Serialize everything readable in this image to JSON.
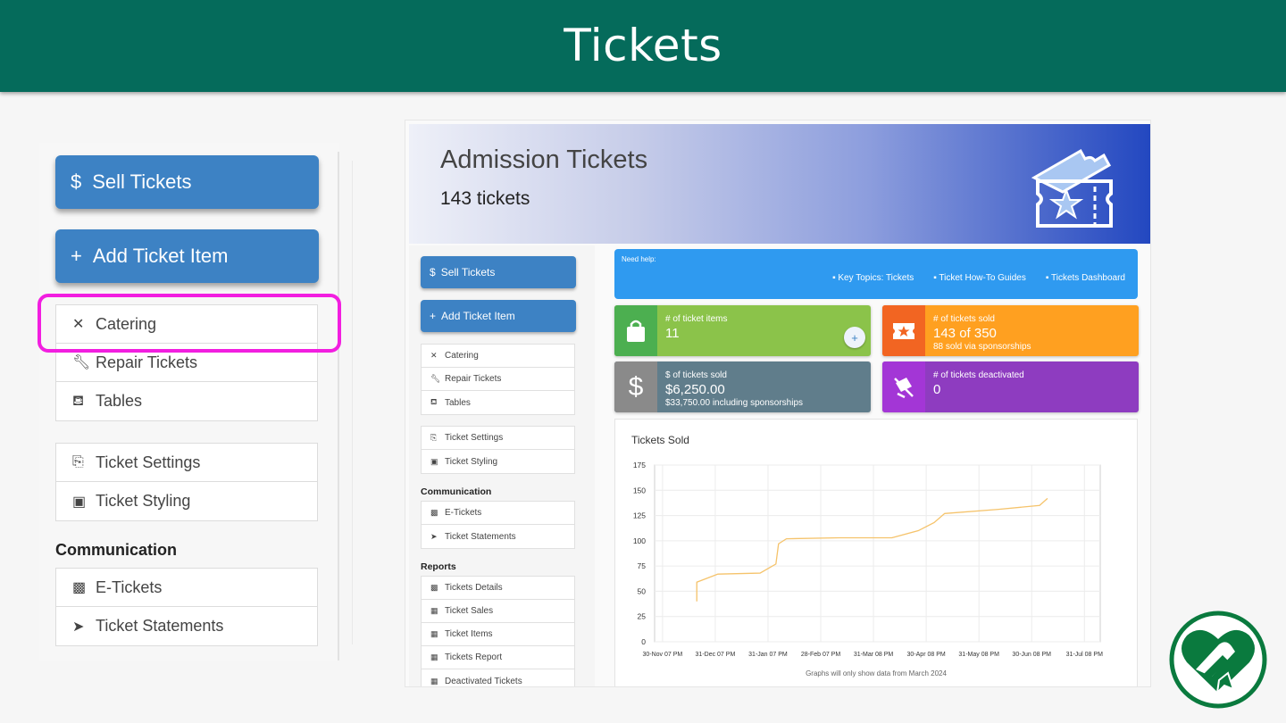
{
  "page_title": "Tickets",
  "zoom": {
    "sell_label": "Sell Tickets",
    "add_label": "Add Ticket Item",
    "group1": [
      "Catering",
      "Repair Tickets",
      "Tables"
    ],
    "group2": [
      "Ticket Settings",
      "Ticket Styling"
    ],
    "communication_heading": "Communication",
    "group3": [
      "E-Tickets",
      "Ticket Statements"
    ]
  },
  "header": {
    "title": "Admission Tickets",
    "subtitle": "143 tickets"
  },
  "sidebar": {
    "sell_label": "Sell Tickets",
    "add_label": "Add Ticket Item",
    "group1": [
      "Catering",
      "Repair Tickets",
      "Tables"
    ],
    "group2": [
      "Ticket Settings",
      "Ticket Styling"
    ],
    "communication_heading": "Communication",
    "communication": [
      "E-Tickets",
      "Ticket Statements"
    ],
    "reports_heading": "Reports",
    "reports": [
      "Tickets Details",
      "Ticket Sales",
      "Ticket Items",
      "Tickets Report",
      "Deactivated Tickets"
    ]
  },
  "help": {
    "label": "Need help:",
    "links": [
      "Key Topics: Tickets",
      "Ticket How-To Guides",
      "Tickets Dashboard"
    ]
  },
  "cards": {
    "items": {
      "label": "# of ticket items",
      "value": "11",
      "color": "#8bc34a"
    },
    "sold": {
      "label": "# of tickets sold",
      "value": "143 of 350",
      "sub": "88 sold via sponsorships",
      "color": "#ffa020"
    },
    "dollars": {
      "label": "$ of tickets sold",
      "value": "$6,250.00",
      "sub": "$33,750.00 including sponsorships",
      "color": "#607d8b"
    },
    "deactivated": {
      "label": "# of tickets deactivated",
      "value": "0",
      "color": "#8e3cc0"
    }
  },
  "chart_note": "Graphs will only show data from March 2024",
  "chart_data": {
    "type": "line",
    "title": "Tickets Sold",
    "x_ticks": [
      "30-Nov 07 PM",
      "31-Dec 07 PM",
      "31-Jan 07 PM",
      "28-Feb 07 PM",
      "31-Mar 08 PM",
      "30-Apr 08 PM",
      "31-May 08 PM",
      "30-Jun 08 PM",
      "31-Jul 08 PM"
    ],
    "y_ticks": [
      0,
      25,
      50,
      75,
      100,
      125,
      150,
      175
    ],
    "ylim": [
      0,
      175
    ],
    "series": [
      {
        "color": "#f5c36b",
        "x": [
          0.8,
          0.8,
          1.2,
          2.0,
          2.3,
          2.35,
          2.5,
          3.5,
          4.0,
          4.5,
          5.0,
          5.3,
          5.5,
          6.5,
          7.3,
          7.45
        ],
        "y": [
          40,
          59,
          67,
          68,
          77,
          97,
          102,
          103,
          103,
          103,
          110,
          118,
          127,
          131,
          135,
          142
        ]
      }
    ],
    "grid": true
  }
}
